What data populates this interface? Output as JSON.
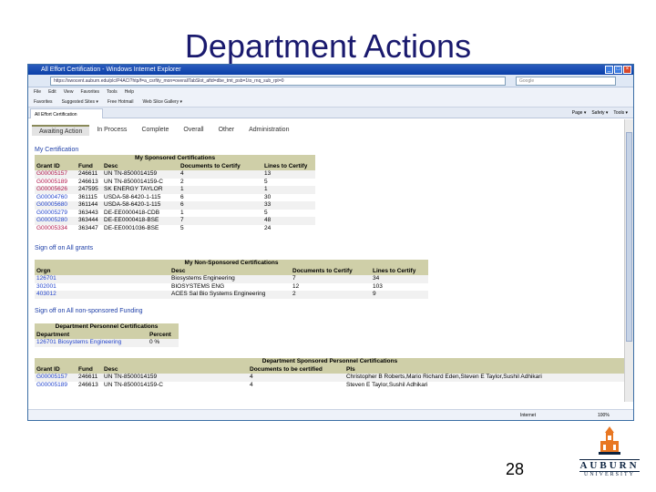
{
  "slide": {
    "title": "Department Actions",
    "page_number": "28",
    "logo": {
      "word": "AUBURN",
      "sub": "UNIVERSITY"
    }
  },
  "browser": {
    "window_title": "All Effort Certification - Windows Internet Explorer",
    "address": "https://swocent.auburn.edu/plc/P4ACI?htp/f=a_csrfity_mon=overallTabSlot_aftd=dbe_tmt_psb=1to_rnq_sub_rpt=0",
    "search_placeholder": "Google",
    "menu": [
      "File",
      "Edit",
      "View",
      "Favorites",
      "Tools",
      "Help"
    ],
    "favorites": [
      "Favorites",
      "Suggested Sites ▾",
      "Free Hotmail",
      "Web Slice Gallery ▾"
    ],
    "tab_label": "All Effort Certification",
    "tools": [
      "Page ▾",
      "Safety ▾",
      "Tools ▾"
    ],
    "status_zone": "Internet",
    "status_zoom": "100%"
  },
  "app": {
    "nav_tabs": [
      "Awaiting Action",
      "In Process",
      "Complete",
      "Overall",
      "Other",
      "Administration"
    ],
    "my_certification": "My Certification",
    "sponsored": {
      "caption": "My Sponsored Certifications",
      "columns": [
        "Grant ID",
        "Fund",
        "Desc",
        "Documents to Certify",
        "Lines to Certify"
      ],
      "rows": [
        [
          "G00005157",
          "246611",
          "UN TN-8500014159",
          "4",
          "13"
        ],
        [
          "G00005189",
          "246613",
          "UN TN-8500014159-C",
          "2",
          "5"
        ],
        [
          "G00005626",
          "247595",
          "SK ENERGY TAYLOR",
          "1",
          "1"
        ],
        [
          "G00004760",
          "361115",
          "USDA-58-6420-1-115",
          "6",
          "30"
        ],
        [
          "G00005680",
          "361144",
          "USDA-58-6420-1-115",
          "6",
          "33"
        ],
        [
          "G00005279",
          "363443",
          "DE-EE0000418-CDB",
          "1",
          "5"
        ],
        [
          "G00005280",
          "363444",
          "DE-EE0000418-BSE",
          "7",
          "48"
        ],
        [
          "G00005334",
          "363447",
          "DE-EE0001036-BSE",
          "5",
          "24"
        ]
      ],
      "signoff": "Sign off on All grants"
    },
    "non_sponsored": {
      "caption": "My Non-Sponsored Certifications",
      "columns": [
        "Orgn",
        "Desc",
        "Documents to Certify",
        "Lines to Certify"
      ],
      "rows": [
        [
          "126701",
          "Biosystems Engineering",
          "7",
          "34"
        ],
        [
          "302001",
          "BIOSYSTEMS ENG",
          "12",
          "103"
        ],
        [
          "403012",
          "ACES Sal Bio Systems Engineering",
          "2",
          "9"
        ]
      ],
      "signoff": "Sign off on All non-sponsored Funding"
    },
    "dept_personnel": {
      "caption": "Department Personnel Certifications",
      "columns": [
        "Department",
        "Percent"
      ],
      "rows": [
        [
          "126701 Biosystems Engineering",
          "0 %"
        ]
      ]
    },
    "dept_sponsored": {
      "caption": "Department Sponsored Personnel Certifications",
      "columns": [
        "Grant ID",
        "Fund",
        "Desc",
        "Documents to be certified",
        "PIs"
      ],
      "rows": [
        [
          "G00005157",
          "246611",
          "UN TN-8500014159",
          "4",
          "Christopher B Roberts,Mario Richard Eden,Steven E Taylor,Sushil Adhikari"
        ],
        [
          "G00005189",
          "246613",
          "UN TN-8500014159-C",
          "4",
          "Steven E Taylor,Sushil Adhikari"
        ]
      ]
    }
  }
}
